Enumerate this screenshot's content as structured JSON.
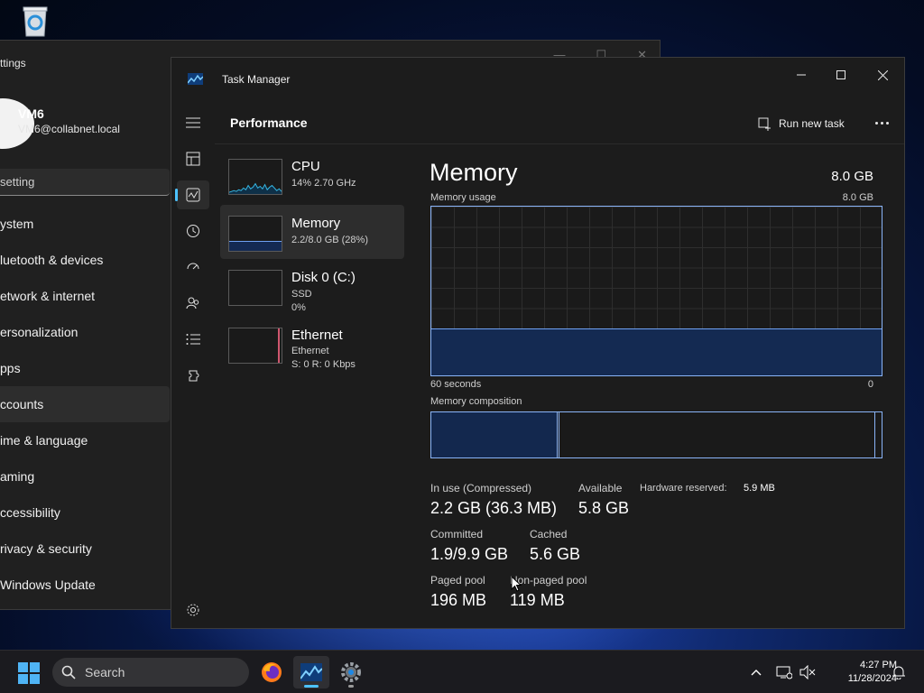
{
  "settings": {
    "title": "ttings",
    "user_name": "VM6",
    "user_email": "VM6@collabnet.local",
    "search_placeholder": "setting",
    "nav": [
      "ystem",
      "luetooth & devices",
      "etwork & internet",
      "ersonalization",
      "pps",
      "ccounts",
      "ime & language",
      "aming",
      "ccessibility",
      "rivacy & security",
      "Windows Update"
    ],
    "active_index": 5
  },
  "task_manager": {
    "title": "Task Manager",
    "page_title": "Performance",
    "run_new_task": "Run new task",
    "rail_icons": [
      "hamburger-menu-icon",
      "processes-icon",
      "performance-icon",
      "app-history-icon",
      "startup-apps-icon",
      "users-icon",
      "details-icon",
      "services-icon",
      "settings-icon"
    ],
    "list": [
      {
        "name": "CPU",
        "line1": "14%  2.70 GHz",
        "line2": ""
      },
      {
        "name": "Memory",
        "line1": "2.2/8.0 GB (28%)",
        "line2": ""
      },
      {
        "name": "Disk 0 (C:)",
        "line1": "SSD",
        "line2": "0%"
      },
      {
        "name": "Ethernet",
        "line1": "Ethernet",
        "line2": "S: 0  R: 0 Kbps"
      }
    ],
    "active_item": 1,
    "memory": {
      "heading": "Memory",
      "total": "8.0 GB",
      "usage_label": "Memory usage",
      "usage_max": "8.0 GB",
      "usage_fraction": 0.28,
      "time_left": "60 seconds",
      "time_right": "0",
      "composition_label": "Memory composition",
      "composition": {
        "in_use": 0.28,
        "modified": 0.005,
        "standby": 0.7
      },
      "stats": {
        "in_use_label": "In use (Compressed)",
        "in_use_value": "2.2 GB (36.3 MB)",
        "available_label": "Available",
        "available_value": "5.8 GB",
        "hw_reserved_label": "Hardware reserved:",
        "hw_reserved_value": "5.9 MB",
        "committed_label": "Committed",
        "committed_value": "1.9/9.9 GB",
        "cached_label": "Cached",
        "cached_value": "5.6 GB",
        "paged_label": "Paged pool",
        "paged_value": "196 MB",
        "nonpaged_label": "Non-paged pool",
        "nonpaged_value": "119 MB"
      }
    }
  },
  "taskbar": {
    "search_label": "Search",
    "time": "4:27 PM",
    "date": "11/28/2024",
    "accent": "#4cc2ff"
  }
}
